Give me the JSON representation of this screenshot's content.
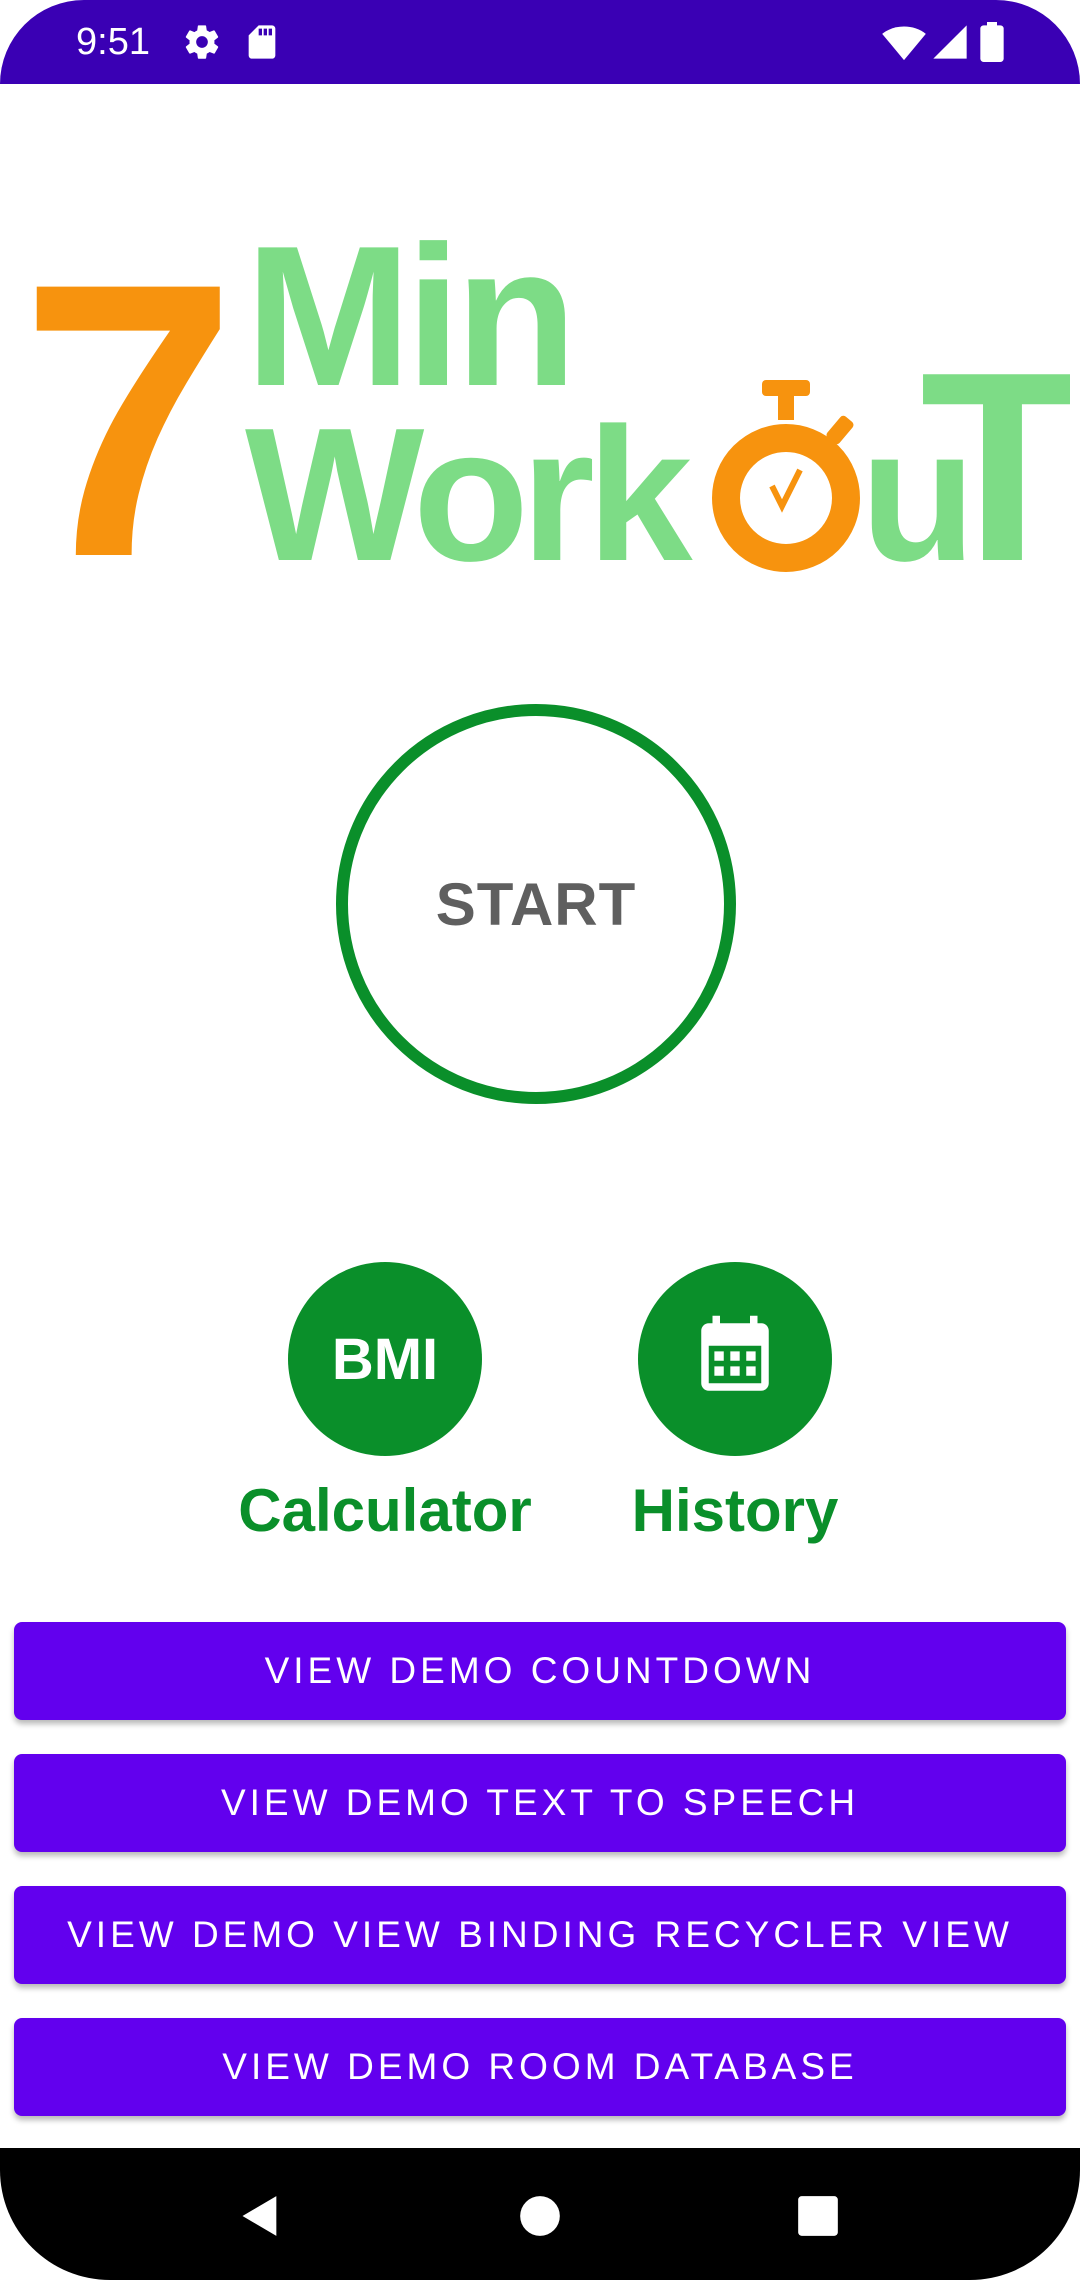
{
  "status_bar": {
    "time": "9:51",
    "icons": [
      "settings-icon",
      "sd-card-icon",
      "wifi-icon",
      "cell-signal-icon",
      "battery-icon"
    ],
    "background_color": "#3a00b4"
  },
  "logo": {
    "digit": "7",
    "word_top": "Min",
    "word_bottom_pre": "Work",
    "word_bottom_post": "u",
    "letter_end": "T",
    "colors": {
      "orange": "#f7930e",
      "green": "#7ddc86"
    }
  },
  "start": {
    "label": "START",
    "ring_color": "#0a8f2a"
  },
  "actions": {
    "bmi": {
      "icon_text": "BMI",
      "caption": "Calculator"
    },
    "history": {
      "icon": "calendar-icon",
      "caption": "History"
    },
    "color": "#0a8f2a"
  },
  "demo_buttons": [
    "VIEW DEMO COUNTDOWN",
    "VIEW DEMO TEXT TO SPEECH",
    "VIEW DEMO VIEW BINDING RECYCLER VIEW",
    "VIEW DEMO ROOM DATABASE"
  ],
  "demo_button_color": "#6200ee",
  "nav_bar": {
    "icons": [
      "back-icon",
      "home-icon",
      "recents-icon"
    ]
  }
}
